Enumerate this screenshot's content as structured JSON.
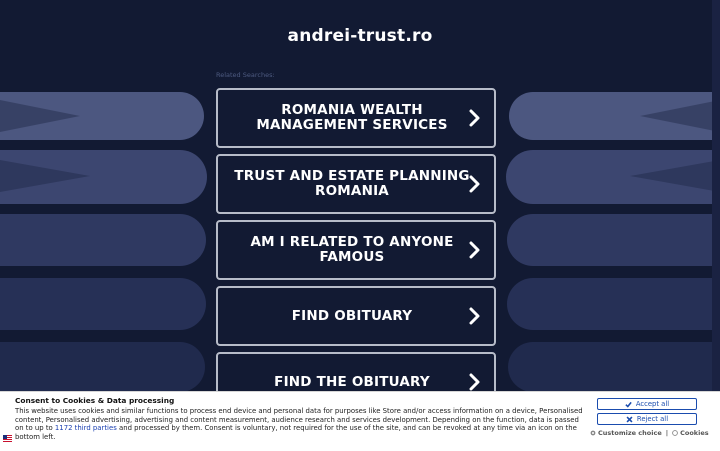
{
  "site": {
    "title": "andrei-trust.ro"
  },
  "related": {
    "label": "Related Searches:",
    "items": [
      {
        "label": "ROMANIA WEALTH MANAGEMENT SERVICES"
      },
      {
        "label": "TRUST AND ESTATE PLANNING ROMANIA"
      },
      {
        "label": "AM I RELATED TO ANYONE FAMOUS"
      },
      {
        "label": "FIND OBITUARY"
      },
      {
        "label": "FIND THE OBITUARY"
      }
    ]
  },
  "consent": {
    "title": "Consent to Cookies & Data processing",
    "text_before": "This website uses cookies and similar functions to process end device and personal data for purposes like Store and/or access information on a device, Personalised content, Personalised advertising, advertising and content measurement, audience research and services development. Depending on the function, data is passed on to up to ",
    "third_parties_link": "1172 third parties",
    "text_after": " and processed by them. Consent is voluntary, not required for the use of the site, and can be revoked at any time via an icon on the bottom left.",
    "accept_label": "Accept all",
    "reject_label": "Reject all",
    "customize_label": "Customize choice",
    "separator": "|",
    "cookies_label": "Cookies"
  },
  "colors": {
    "background": "#121a33",
    "button_border": "#b7bcc9",
    "consent_accent": "#1a4cae"
  }
}
